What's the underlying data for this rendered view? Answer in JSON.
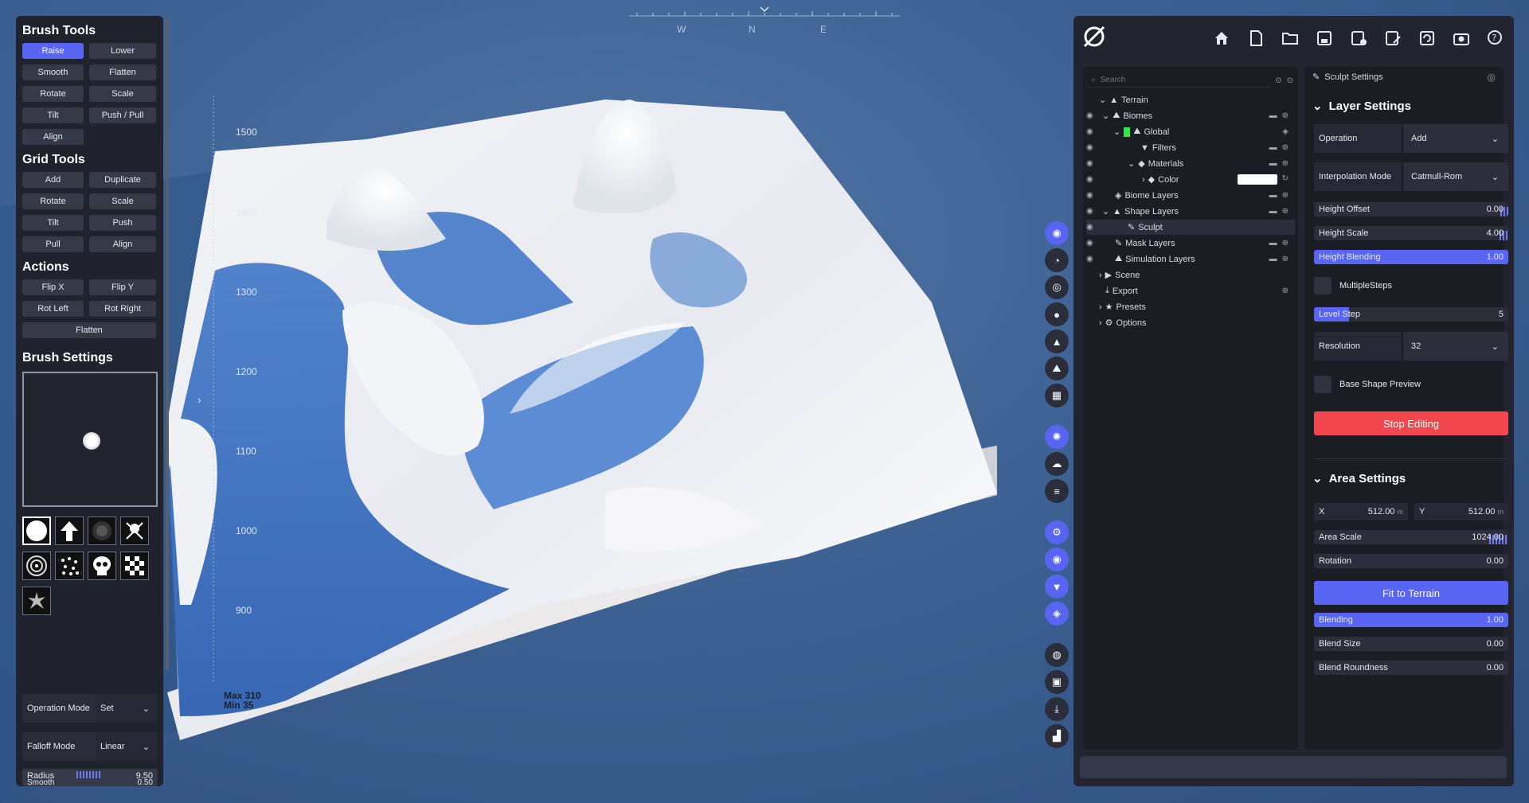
{
  "compass": {
    "labels": [
      "W",
      "N",
      "E"
    ]
  },
  "height_axis": {
    "ticks": [
      "1500",
      "1400",
      "1300",
      "1200",
      "1100",
      "1000",
      "900"
    ]
  },
  "terrain_info": {
    "max": "Max 310",
    "min": "Min 35"
  },
  "left_panel": {
    "brush_tools": {
      "title": "Brush Tools",
      "buttons": [
        "Raise",
        "Lower",
        "Smooth",
        "Flatten",
        "Rotate",
        "Scale",
        "Tilt",
        "Push / Pull",
        "Align"
      ],
      "active": "Raise"
    },
    "grid_tools": {
      "title": "Grid Tools",
      "buttons": [
        "Add",
        "Duplicate",
        "Rotate",
        "Scale",
        "Tilt",
        "Push",
        "Pull",
        "Align"
      ]
    },
    "actions": {
      "title": "Actions",
      "buttons": [
        "Flip X",
        "Flip Y",
        "Rot Left",
        "Rot Right",
        "Flatten"
      ]
    },
    "brush_settings": {
      "title": "Brush Settings"
    },
    "operation_mode": {
      "label": "Operation Mode",
      "value": "Set"
    },
    "falloff_mode": {
      "label": "Falloff Mode",
      "value": "Linear"
    },
    "radius": {
      "label": "Radius",
      "value": "9.50"
    },
    "smooth": {
      "label": "Smooth",
      "value": "0.50"
    }
  },
  "tree": {
    "search_placeholder": "Search",
    "items": [
      {
        "label": "Terrain"
      },
      {
        "label": "Biomes"
      },
      {
        "label": "Global"
      },
      {
        "label": "Filters"
      },
      {
        "label": "Materials"
      },
      {
        "label": "Color"
      },
      {
        "label": "Biome Layers"
      },
      {
        "label": "Shape Layers"
      },
      {
        "label": "Sculpt"
      },
      {
        "label": "Mask Layers"
      },
      {
        "label": "Simulation Layers"
      },
      {
        "label": "Scene"
      },
      {
        "label": "Export"
      },
      {
        "label": "Presets"
      },
      {
        "label": "Options"
      }
    ]
  },
  "props": {
    "header": "Sculpt Settings",
    "layer_settings": {
      "title": "Layer Settings",
      "operation": {
        "label": "Operation",
        "value": "Add"
      },
      "interpolation": {
        "label": "Interpolation Mode",
        "value": "Catmull-Rom"
      },
      "height_offset": {
        "label": "Height Offset",
        "value": "0.00"
      },
      "height_scale": {
        "label": "Height Scale",
        "value": "4.00"
      },
      "height_blending": {
        "label": "Height Blending",
        "value": "1.00",
        "fill": 1.0
      },
      "multiple_steps": {
        "label": "MultipleSteps"
      },
      "level_step": {
        "label": "Level Step",
        "value": "5",
        "fill": 0.18
      },
      "resolution": {
        "label": "Resolution",
        "value": "32"
      },
      "base_shape_preview": {
        "label": "Base Shape Preview"
      },
      "stop_editing": "Stop Editing"
    },
    "area_settings": {
      "title": "Area Settings",
      "x": {
        "label": "X",
        "value": "512.00",
        "unit": "m"
      },
      "y": {
        "label": "Y",
        "value": "512.00",
        "unit": "m"
      },
      "area_scale": {
        "label": "Area Scale",
        "value": "1024.00"
      },
      "rotation": {
        "label": "Rotation",
        "value": "0.00"
      },
      "fit_to_terrain": "Fit to Terrain",
      "blending": {
        "label": "Blending",
        "value": "1.00",
        "fill": 1.0
      },
      "blend_size": {
        "label": "Blend Size",
        "value": "0.00"
      },
      "blend_roundness": {
        "label": "Blend Roundness",
        "value": "0.00"
      }
    }
  },
  "colors": {
    "accent": "#5865f2",
    "danger": "#f2474e",
    "panel": "#20232d"
  }
}
